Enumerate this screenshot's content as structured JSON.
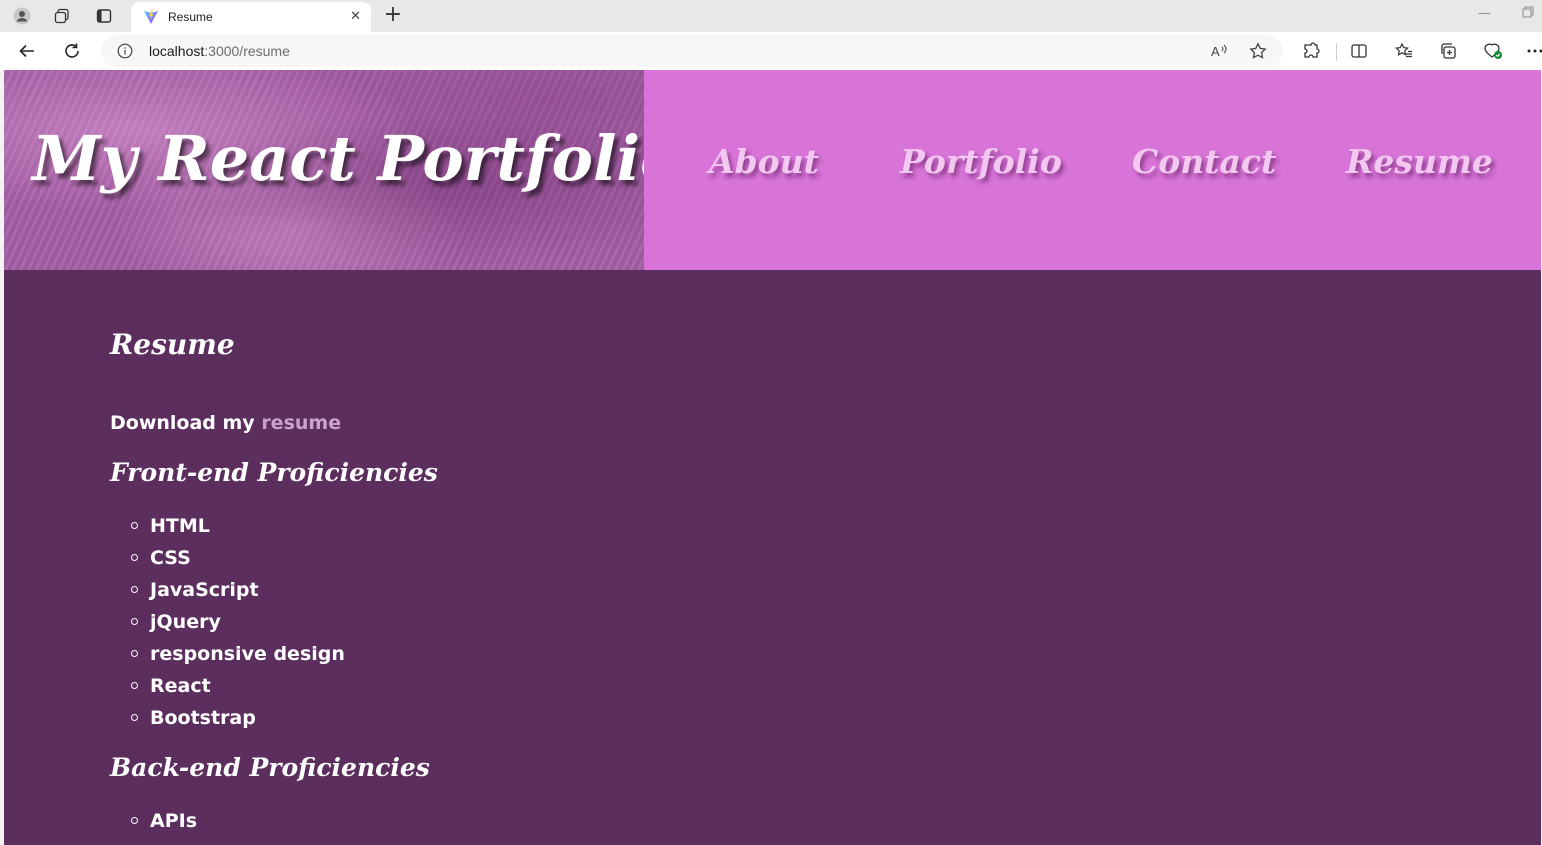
{
  "browser": {
    "tab_title": "Resume",
    "address_host": "localhost",
    "address_rest": ":3000/resume"
  },
  "header": {
    "site_title": "My React Portfolio",
    "nav": [
      "About",
      "Portfolio",
      "Contact",
      "Resume"
    ]
  },
  "main": {
    "heading": "Resume",
    "download_prefix": "Download my ",
    "download_link": "resume",
    "frontend_heading": "Front-end Proficiencies",
    "frontend_skills": [
      "HTML",
      "CSS",
      "JavaScript",
      "jQuery",
      "responsive design",
      "React",
      "Bootstrap"
    ],
    "backend_heading": "Back-end Proficiencies",
    "backend_skills": [
      "APIs"
    ]
  },
  "colors": {
    "page_background": "#5c2e5e",
    "nav_background": "#d873d8",
    "hero_background": "#a65fa6",
    "nav_link_text": "#f3c8f0",
    "link_text": "#c9a3c9"
  }
}
